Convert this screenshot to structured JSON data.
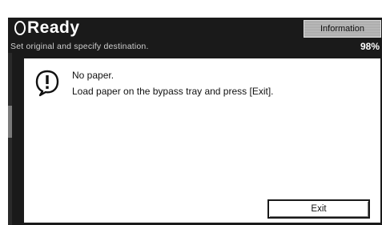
{
  "header": {
    "status_title": "Ready",
    "subtitle": "Set original and specify destination.",
    "information_button_label": "Information",
    "memory_indicator": "98%"
  },
  "dialog": {
    "icon": "warning-icon",
    "message_line1": "No paper.",
    "message_line2": "Load paper on the bypass tray and press [Exit].",
    "exit_button_label": "Exit"
  },
  "colors": {
    "topbar_background": "#1a1a1a",
    "dialog_border": "#1a1a1a",
    "dialog_background": "#ffffff",
    "info_button_background": "#b3b3b3"
  }
}
